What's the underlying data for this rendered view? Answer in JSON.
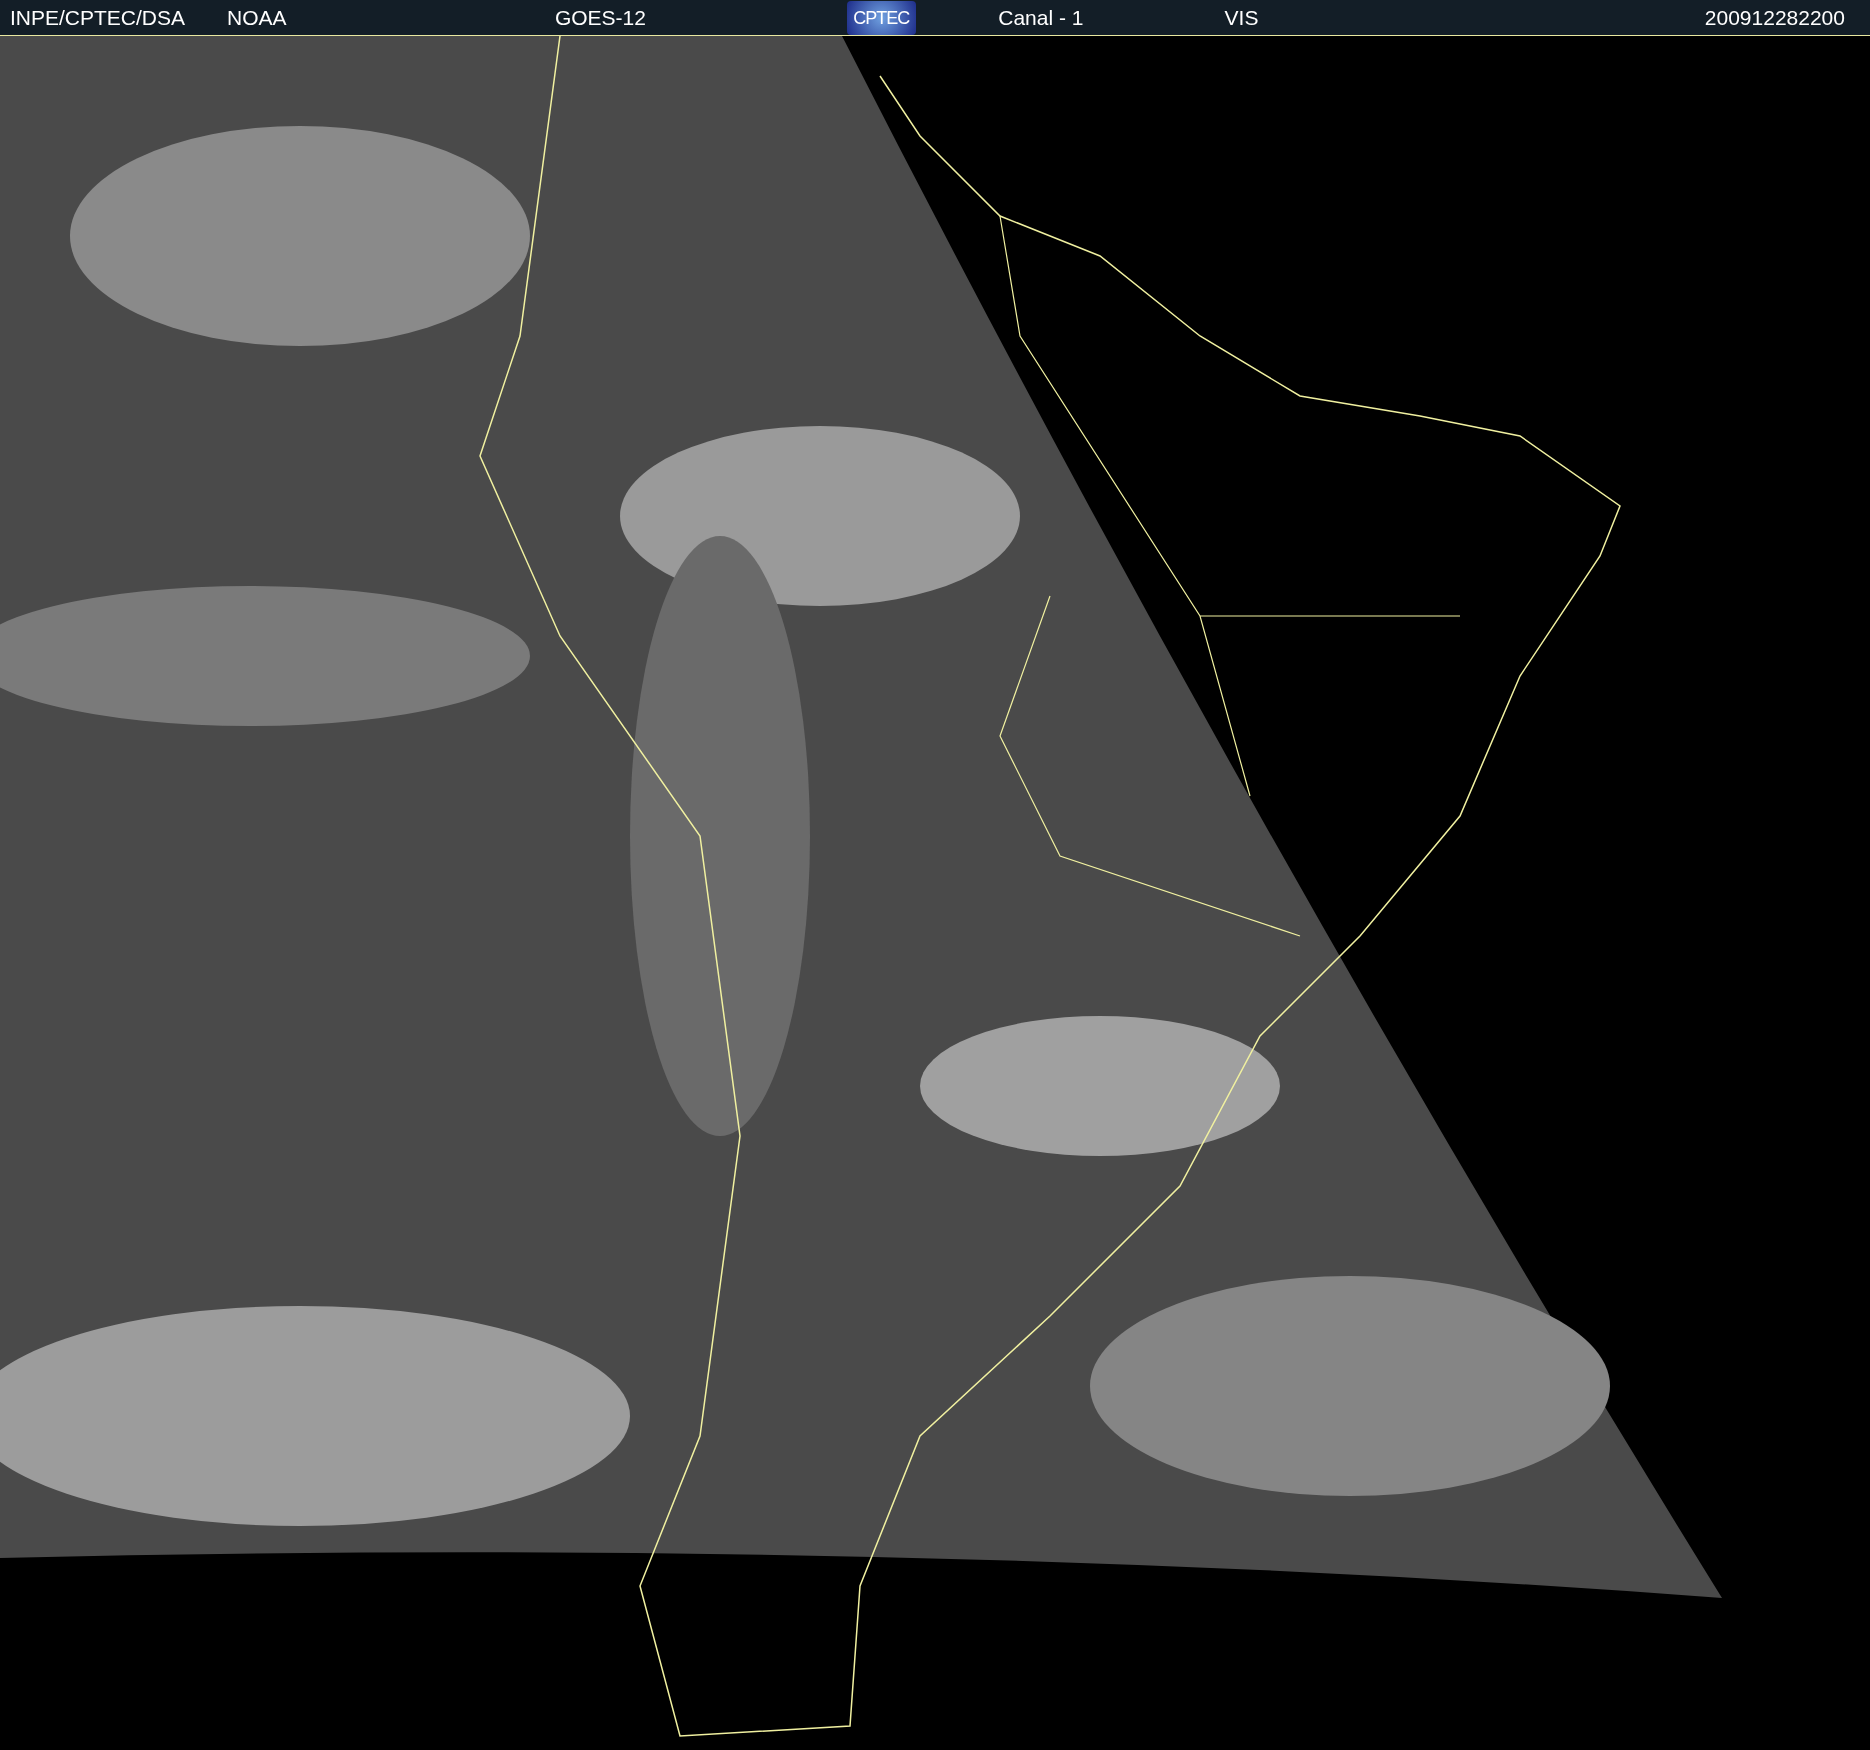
{
  "header": {
    "items": [
      {
        "kind": "text",
        "text": "INPE/CPTEC/DSA"
      },
      {
        "kind": "text",
        "text": "NOAA"
      },
      {
        "kind": "text",
        "text": "GOES-12"
      },
      {
        "kind": "logo",
        "text": "CPTEC"
      },
      {
        "kind": "text",
        "text": "Canal - 1"
      },
      {
        "kind": "text",
        "text": "VIS"
      },
      {
        "kind": "text",
        "text": "200912282200"
      }
    ]
  }
}
